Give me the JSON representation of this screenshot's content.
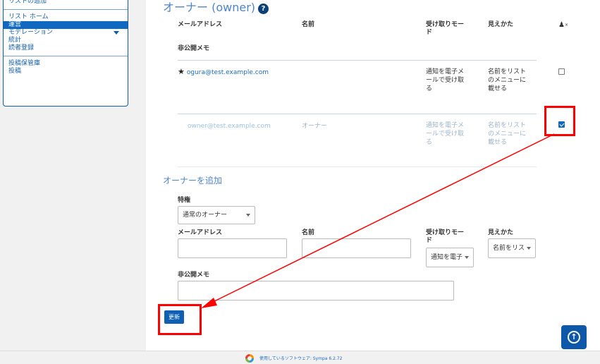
{
  "sidebar": {
    "top_label": "リストの追加",
    "items": [
      {
        "label": "リスト ホーム",
        "active": false
      },
      {
        "label": "運営",
        "active": true
      },
      {
        "label": "モデレーション",
        "active": false,
        "expandable": true
      },
      {
        "label": "統計",
        "active": false
      },
      {
        "label": "読者登録",
        "active": false
      }
    ],
    "items2": [
      {
        "label": "投稿保管庫"
      },
      {
        "label": "投稿"
      }
    ]
  },
  "owners": {
    "heading": "オーナー (owner)",
    "help_icon": "?",
    "columns": {
      "email": "メールアドレス",
      "name": "名前",
      "reception": "受け取りモード",
      "visibility": "見えかた",
      "private_note": "非公開メモ",
      "delete_icon": "user-times-icon"
    },
    "rows": [
      {
        "email": "ogura@test.example.com",
        "name": "",
        "reception": "通知を電子メールで受け取る",
        "visibility": "名前をリストのメニューに載せる",
        "privileged": true,
        "checked": false
      },
      {
        "email": "owner@test.example.com",
        "name": "オーナー",
        "reception": "通知を電子メールで受け取る",
        "visibility": "名前をリストのメニューに載せる",
        "privileged": false,
        "checked": true
      }
    ]
  },
  "add_owner": {
    "heading": "オーナーを追加",
    "privilege_label": "特権",
    "privilege_value": "通常のオーナー",
    "email_label": "メールアドレス",
    "email_value": "",
    "name_label": "名前",
    "name_value": "",
    "reception_label": "受け取りモード",
    "reception_value": "通知を電子",
    "visibility_label": "見えかた",
    "visibility_value": "名前をリス",
    "note_label": "非公開メモ",
    "note_value": "",
    "submit_label": "更新"
  },
  "back_to_top_icon": "arrow-up-circle-icon",
  "footer": {
    "text": "使用しているソフトウェア: Sympa 6.2.72"
  },
  "colors": {
    "accent": "#0f69c0",
    "annotation": "#ff0000"
  }
}
